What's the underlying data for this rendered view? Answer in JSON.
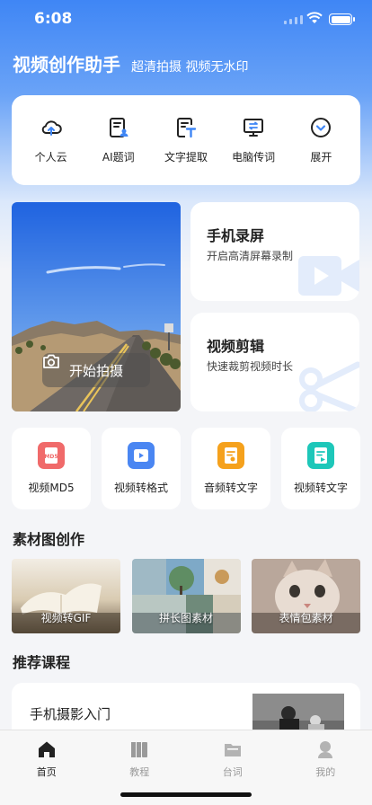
{
  "status_bar": {
    "time": "6:08"
  },
  "header": {
    "title": "视频创作助手",
    "subtitle": "超清拍摄 视频无水印"
  },
  "quick_actions": [
    {
      "label": "个人云",
      "icon": "cloud-upload-icon"
    },
    {
      "label": "AI题词",
      "icon": "ai-script-icon"
    },
    {
      "label": "文字提取",
      "icon": "text-extract-icon"
    },
    {
      "label": "电脑传词",
      "icon": "monitor-transfer-icon"
    },
    {
      "label": "展开",
      "icon": "chevron-down-circle-icon"
    }
  ],
  "camera_card": {
    "button_label": "开始拍摄",
    "icon": "camera-icon"
  },
  "screen_record": {
    "title": "手机录屏",
    "subtitle": "开启高清屏幕录制",
    "icon": "video-camera-icon"
  },
  "video_edit": {
    "title": "视频剪辑",
    "subtitle": "快速裁剪视频时长",
    "icon": "scissors-icon"
  },
  "tools": [
    {
      "label": "视频MD5",
      "icon": "md5-icon",
      "color": "#f06a6a"
    },
    {
      "label": "视频转格式",
      "icon": "video-play-icon",
      "color": "#4a86f2"
    },
    {
      "label": "音频转文字",
      "icon": "audio-text-icon",
      "color": "#f5a11c"
    },
    {
      "label": "视频转文字",
      "icon": "video-text-icon",
      "color": "#1ec7b9"
    }
  ],
  "materials_section": {
    "title": "素材图创作"
  },
  "materials": [
    {
      "label": "视频转GIF"
    },
    {
      "label": "拼长图素材"
    },
    {
      "label": "表情包素材"
    }
  ],
  "courses_section": {
    "title": "推荐课程"
  },
  "courses": [
    {
      "title": "手机摄影入门"
    }
  ],
  "tabbar": [
    {
      "label": "首页",
      "icon": "home-icon",
      "active": true
    },
    {
      "label": "教程",
      "icon": "book-icon",
      "active": false
    },
    {
      "label": "台词",
      "icon": "folder-icon",
      "active": false
    },
    {
      "label": "我的",
      "icon": "profile-icon",
      "active": false
    }
  ],
  "colors": {
    "accent": "#3f86f5",
    "background": "#f4f5f8"
  }
}
